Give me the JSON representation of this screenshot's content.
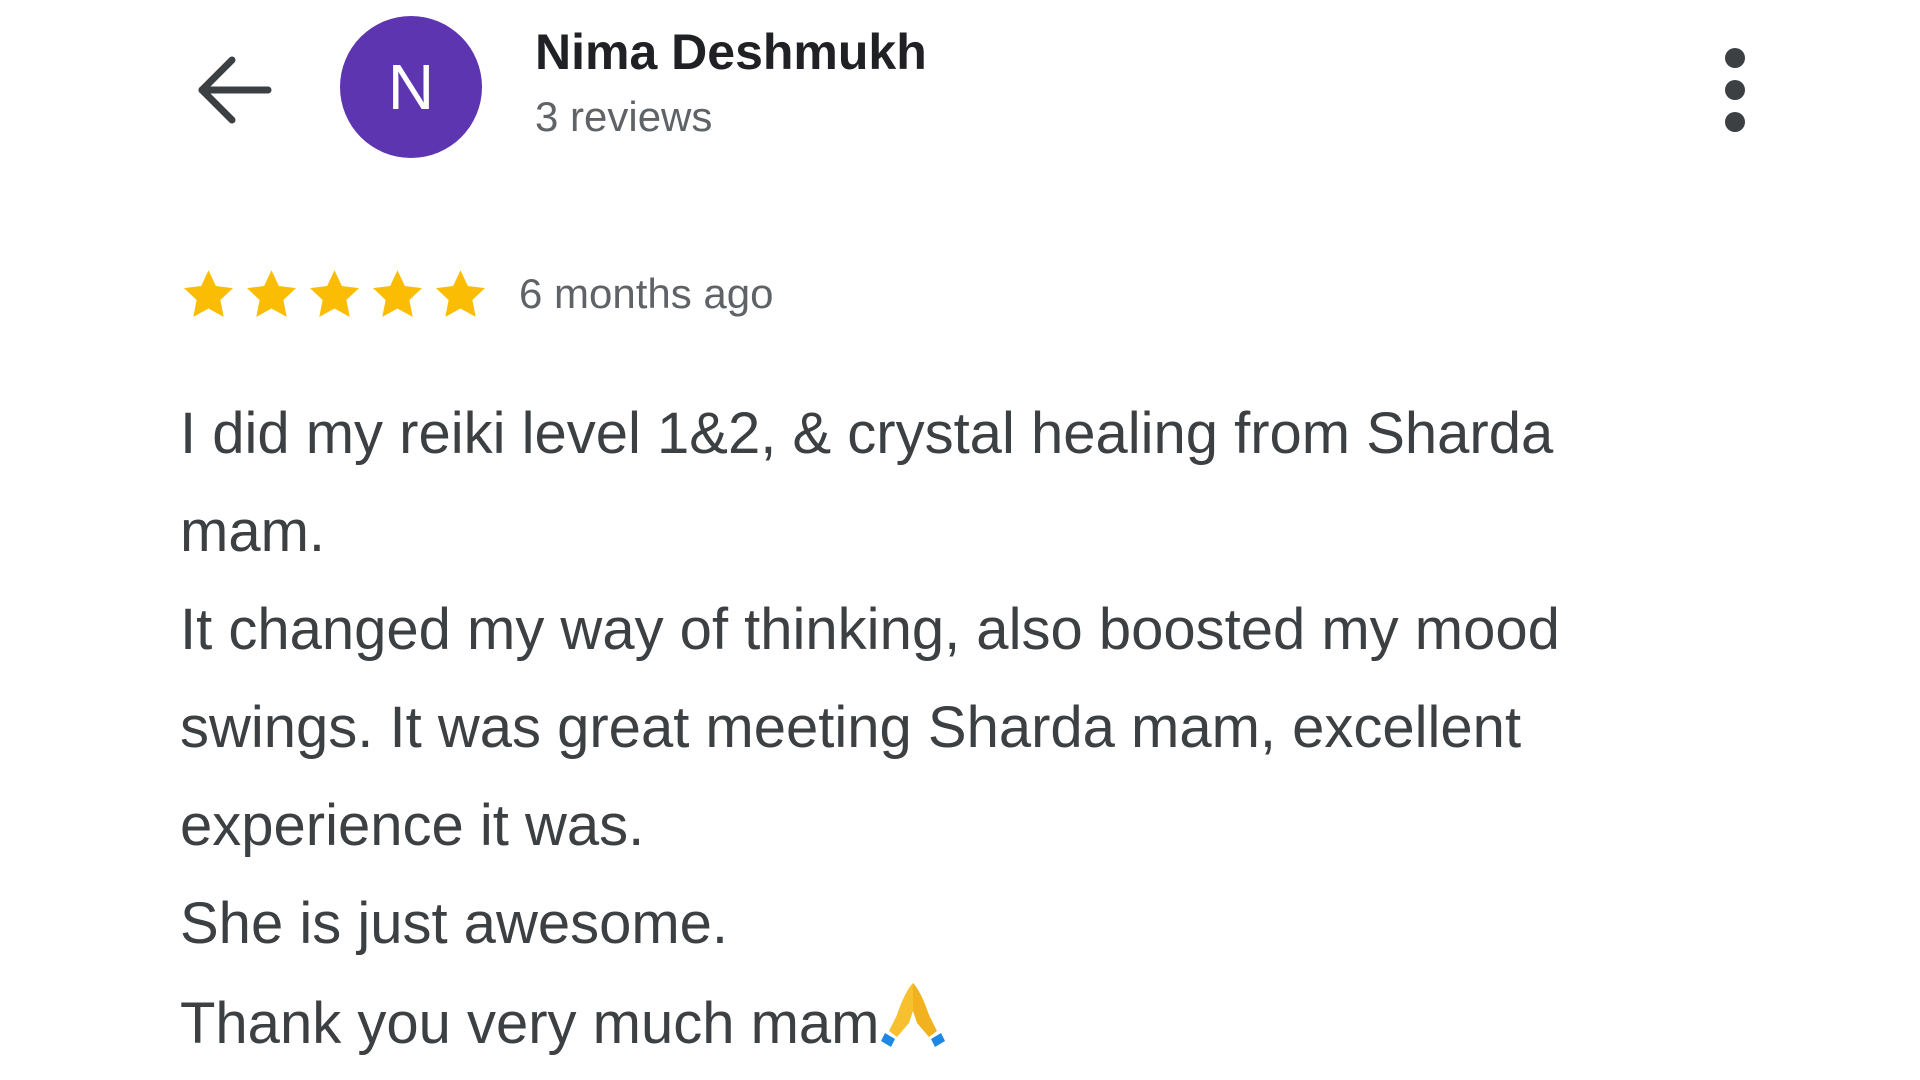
{
  "colors": {
    "avatar_bg": "#5e35b1",
    "star": "#fbbc04",
    "text_primary": "#202124",
    "text_secondary": "#5f6368",
    "icon": "#3c4043"
  },
  "header": {
    "back_icon": "arrow-left-icon",
    "avatar_letter": "N",
    "reviewer_name": "Nima Deshmukh",
    "review_count": "3 reviews",
    "more_icon": "more-vertical-icon"
  },
  "review": {
    "rating": 5,
    "rating_max": 5,
    "date": "6 months ago",
    "lines": [
      "I did my reiki level 1&2, & crystal healing from Sharda",
      "mam.",
      "It changed my way of thinking, also boosted my mood",
      "swings. It was great meeting Sharda mam, excellent",
      "experience it was.",
      "She is just awesome.",
      "Thank you very much mam"
    ],
    "closing_emoji": "folded-hands-emoji"
  }
}
